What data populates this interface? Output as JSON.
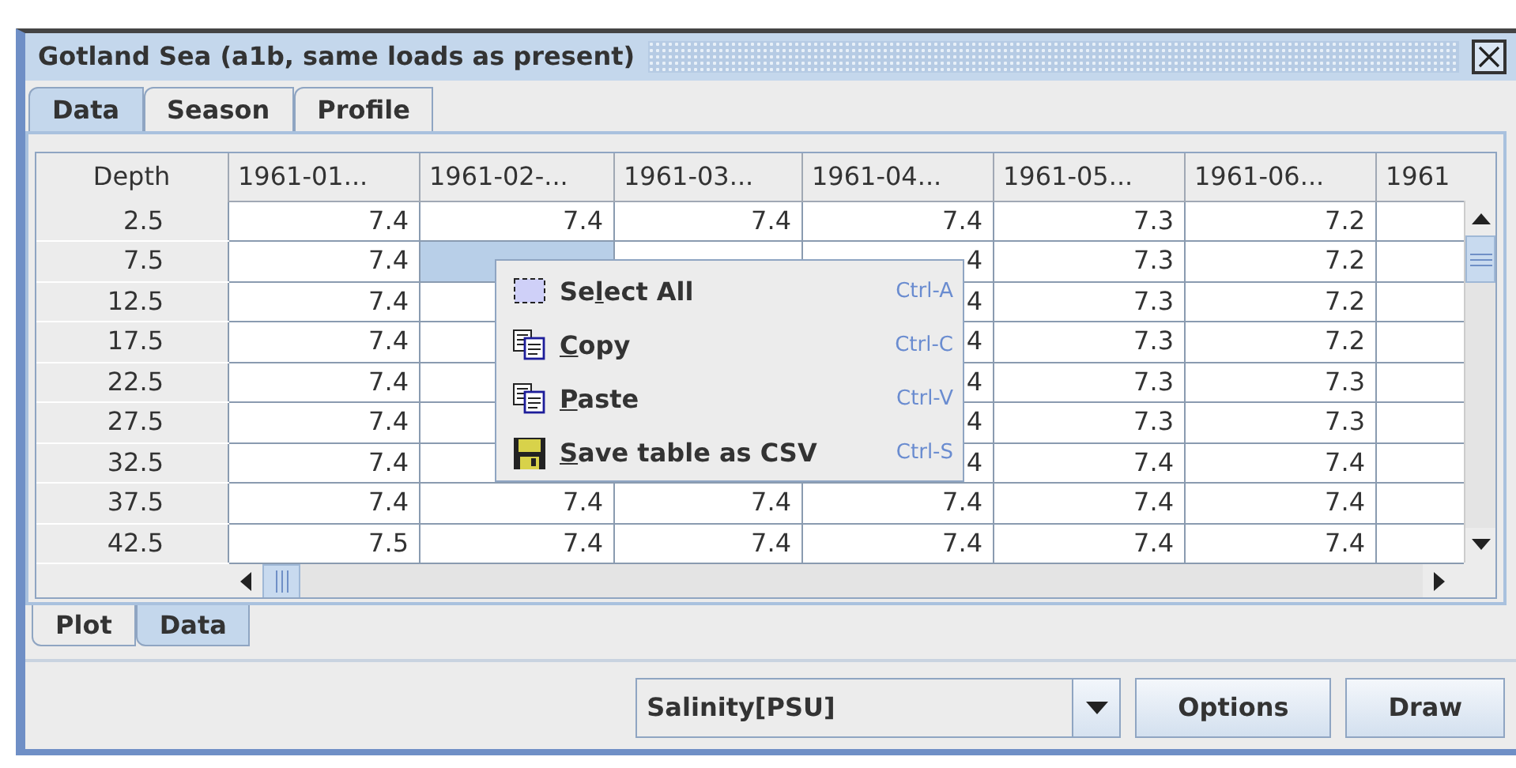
{
  "window": {
    "title": "Gotland Sea (a1b, same loads as present)"
  },
  "tabs": [
    {
      "label": "Data",
      "selected": true
    },
    {
      "label": "Season",
      "selected": false
    },
    {
      "label": "Profile",
      "selected": false
    }
  ],
  "table": {
    "corner_label": "Depth",
    "columns": [
      "1961-01...",
      "1961-02-...",
      "1961-03...",
      "1961-04...",
      "1961-05...",
      "1961-06...",
      "1961"
    ],
    "rows": [
      {
        "depth": "2.5",
        "cells": [
          {
            "text": "7.4",
            "selected": false
          },
          {
            "text": "7.4",
            "selected": false
          },
          {
            "text": "7.4",
            "selected": false
          },
          {
            "text": "7.4",
            "selected": false
          },
          {
            "text": "7.3",
            "selected": false
          },
          {
            "text": "7.2",
            "selected": false
          }
        ]
      },
      {
        "depth": "7.5",
        "cells": [
          {
            "text": "7.4",
            "selected": false
          },
          {
            "selected": true
          },
          null,
          {
            "text": "4",
            "selected": false
          },
          {
            "text": "7.3",
            "selected": false
          },
          {
            "text": "7.2",
            "selected": false
          }
        ]
      },
      {
        "depth": "12.5",
        "cells": [
          {
            "text": "7.4",
            "selected": false
          },
          null,
          null,
          {
            "text": "4",
            "selected": false
          },
          {
            "text": "7.3",
            "selected": false
          },
          {
            "text": "7.2",
            "selected": false
          }
        ]
      },
      {
        "depth": "17.5",
        "cells": [
          {
            "text": "7.4",
            "selected": false
          },
          null,
          null,
          {
            "text": "4",
            "selected": false
          },
          {
            "text": "7.3",
            "selected": false
          },
          {
            "text": "7.2",
            "selected": false
          }
        ]
      },
      {
        "depth": "22.5",
        "cells": [
          {
            "text": "7.4",
            "selected": false
          },
          null,
          null,
          {
            "text": "4",
            "selected": false
          },
          {
            "text": "7.3",
            "selected": false
          },
          {
            "text": "7.3",
            "selected": false
          }
        ]
      },
      {
        "depth": "27.5",
        "cells": [
          {
            "text": "7.4",
            "selected": false
          },
          null,
          null,
          {
            "text": "4",
            "selected": false
          },
          {
            "text": "7.3",
            "selected": false
          },
          {
            "text": "7.3",
            "selected": false
          }
        ]
      },
      {
        "depth": "32.5",
        "cells": [
          {
            "text": "7.4",
            "selected": false
          },
          null,
          null,
          {
            "text": "4",
            "selected": false
          },
          {
            "text": "7.4",
            "selected": false
          },
          {
            "text": "7.4",
            "selected": false
          }
        ]
      },
      {
        "depth": "37.5",
        "cells": [
          {
            "text": "7.4",
            "selected": false
          },
          {
            "text": "7.4",
            "selected": false
          },
          {
            "text": "7.4",
            "selected": false
          },
          {
            "text": "7.4",
            "selected": false
          },
          {
            "text": "7.4",
            "selected": false
          },
          {
            "text": "7.4",
            "selected": false
          }
        ]
      },
      {
        "depth": "42.5",
        "cells": [
          {
            "text": "7.5",
            "selected": false
          },
          {
            "text": "7.4",
            "selected": false
          },
          {
            "text": "7.4",
            "selected": false
          },
          {
            "text": "7.4",
            "selected": false
          },
          {
            "text": "7.4",
            "selected": false
          },
          {
            "text": "7.4",
            "selected": false
          }
        ]
      }
    ]
  },
  "context_menu": {
    "items": [
      {
        "kind": "select-all",
        "label": {
          "before": "Se",
          "key": "l",
          "after": "ect All"
        },
        "shortcut": "Ctrl-A"
      },
      {
        "kind": "copy",
        "label": {
          "key": "C",
          "after": "opy"
        },
        "shortcut": "Ctrl-C"
      },
      {
        "kind": "paste",
        "label": {
          "key": "P",
          "after": "aste"
        },
        "shortcut": "Ctrl-V"
      },
      {
        "kind": "save",
        "label": {
          "key": "S",
          "after": "ave table as CSV"
        },
        "shortcut": "Ctrl-S"
      }
    ]
  },
  "bottom_tabs": [
    {
      "label": "Plot",
      "selected": false
    },
    {
      "label": "Data",
      "selected": true
    }
  ],
  "toolbar": {
    "dropdown": {
      "value": "Salinity[PSU]"
    },
    "buttons": [
      "Options",
      "Draw"
    ]
  }
}
